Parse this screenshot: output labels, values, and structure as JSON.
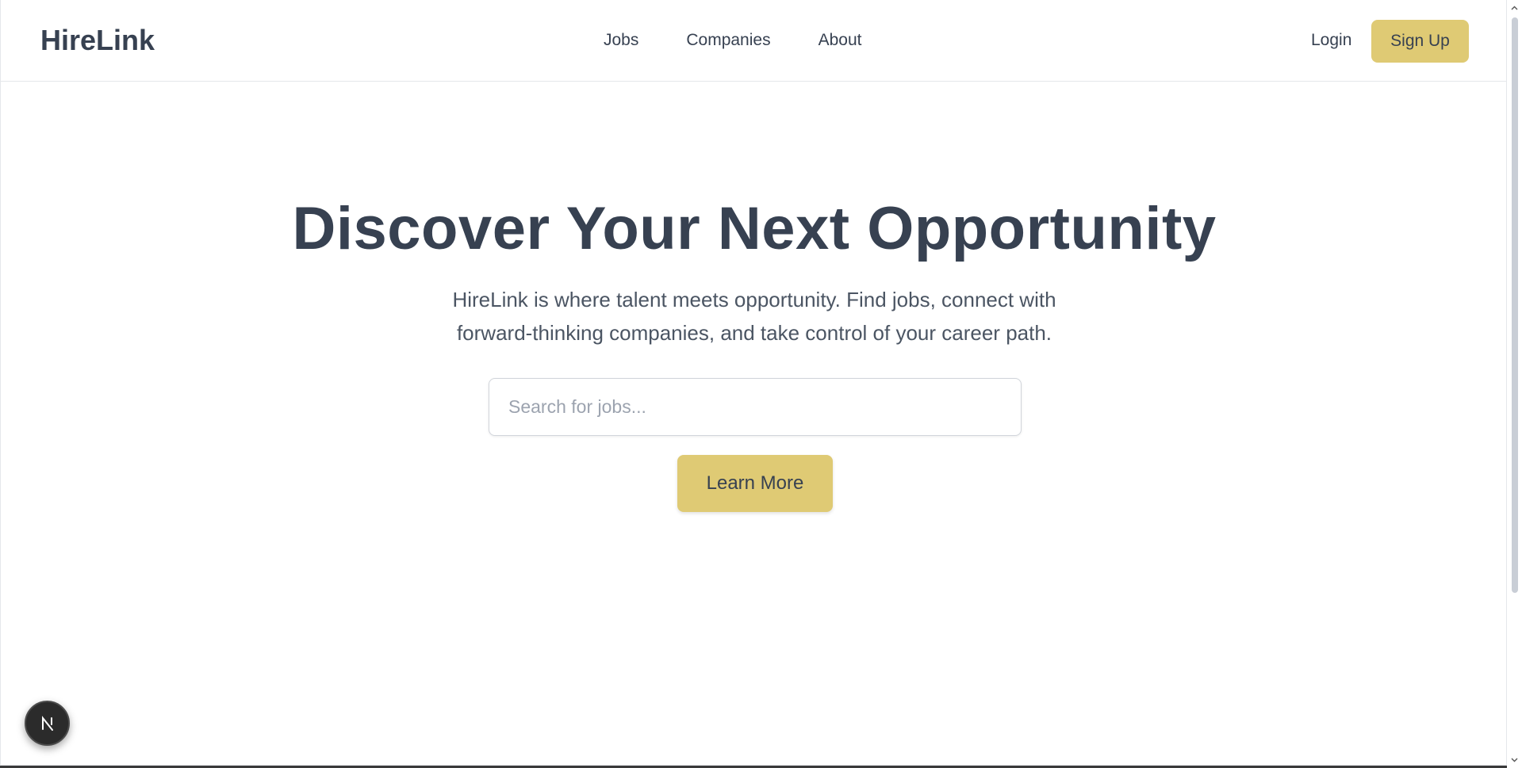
{
  "navbar": {
    "brand": "HireLink",
    "links": [
      {
        "label": "Jobs"
      },
      {
        "label": "Companies"
      },
      {
        "label": "About"
      }
    ],
    "login_label": "Login",
    "signup_label": "Sign Up"
  },
  "hero": {
    "title": "Discover Your Next Opportunity",
    "subtitle": "HireLink is where talent meets opportunity. Find jobs, connect with forward-thinking companies, and take control of your career path.",
    "search_placeholder": "Search for jobs...",
    "search_value": "",
    "cta_label": "Learn More"
  },
  "dev_badge": {
    "letter": "N"
  },
  "colors": {
    "accent": "#dfca74",
    "text": "#374151",
    "muted_text": "#4b5563"
  },
  "icons": {
    "dev_badge": "nextjs-logo-icon",
    "scroll_up": "chevron-up-icon",
    "scroll_down": "chevron-down-icon"
  }
}
